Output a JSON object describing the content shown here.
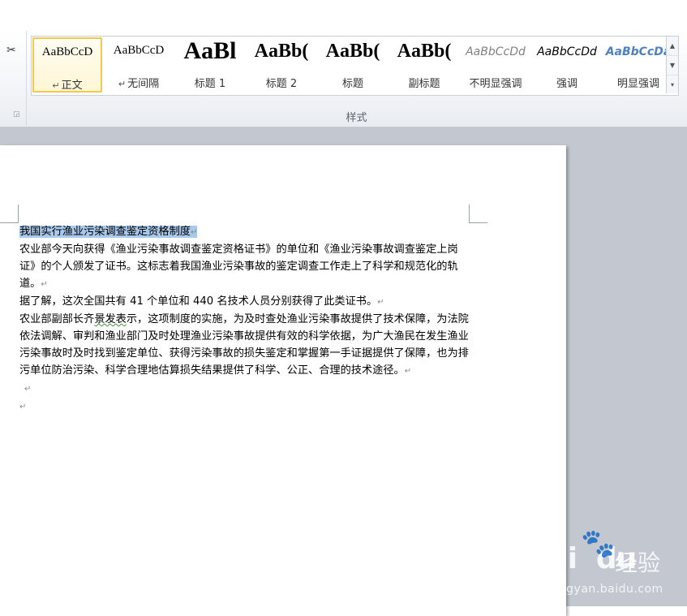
{
  "ribbon": {
    "group_label": "样式",
    "styles": [
      {
        "sample": "AaBbCcD",
        "name": "正文",
        "para_mark": "↵",
        "selected": true,
        "color": "#000000"
      },
      {
        "sample": "AaBbCcD",
        "name": "无间隔",
        "para_mark": "↵",
        "selected": false,
        "color": "#000000"
      },
      {
        "sample": "AaBl",
        "name": "标题 1",
        "para_mark": "",
        "selected": false,
        "color": "#000000"
      },
      {
        "sample": "AaBb(",
        "name": "标题 2",
        "para_mark": "",
        "selected": false,
        "color": "#000000"
      },
      {
        "sample": "AaBb(",
        "name": "标题",
        "para_mark": "",
        "selected": false,
        "color": "#000000"
      },
      {
        "sample": "AaBb(",
        "name": "副标题",
        "para_mark": "",
        "selected": false,
        "color": "#000000"
      },
      {
        "sample": "AaBbCcDd",
        "name": "不明显强调",
        "para_mark": "",
        "selected": false,
        "color": "#808080"
      },
      {
        "sample": "AaBbCcDd",
        "name": "强调",
        "para_mark": "",
        "selected": false,
        "color": "#000000"
      },
      {
        "sample": "AaBbCcDa",
        "name": "明显强调",
        "para_mark": "",
        "selected": false,
        "color": "#4f81bd"
      }
    ]
  },
  "document": {
    "title": "我国实行渔业污染调查鉴定资格制度",
    "para1": "农业部今天向获得《渔业污染事故调查鉴定资格证书》的单位和《渔业污染事故调查鉴定上岗证》的个人颁发了证书。这标志着我国渔业污染事故的鉴定调查工作走上了科学和规范化的轨道。",
    "para2": "据了解，这次全国共有 41 个单位和 440 名技术人员分别获得了此类证书。",
    "para3_start": "农业部副部长齐",
    "para3_wavy": "景发表",
    "para3_rest": "示，这项制度的实施，为及时查处渔业污染事故提供了技术保障，为法院依法调解、审判和渔业部门及时处理渔业污染事故提供有效的科学依据，为广大渔民在发生渔业污染事故时及时找到鉴定单位、获得污染事故的损失鉴定和掌握第一手证据提供了保障，也为排污单位防治污染、科学合理地估算损失结果提供了科学、公正、合理的技术途径。",
    "para_mark": "↵"
  },
  "watermark": {
    "logo": "Bai",
    "logo_tail": "du",
    "cn": "经验",
    "url": "jingyan.baidu.com"
  },
  "colors": {
    "selection": "#a8c8ec",
    "workspace": "#c3c8d0",
    "selected_style_border": "#f2c94c"
  }
}
